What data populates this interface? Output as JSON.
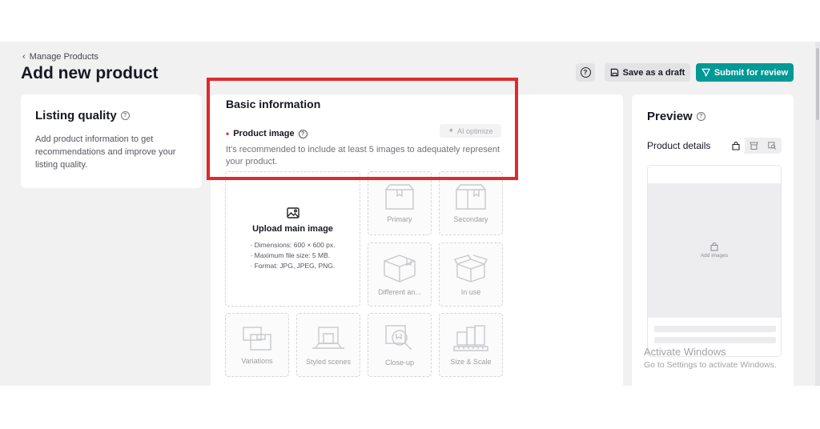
{
  "header": {
    "breadcrumb": "Manage Products",
    "title": "Add new product",
    "draft_label": "Save as a draft",
    "submit_label": "Submit for review"
  },
  "listing_quality": {
    "title": "Listing quality",
    "description": "Add product information to get recommendations and improve your listing quality."
  },
  "basic_info": {
    "title": "Basic information",
    "product_image_label": "Product image",
    "ai_optimize_label": "AI optimize",
    "hint": "It's recommended to include at least 5 images to adequately represent your product.",
    "upload": {
      "title": "Upload main image",
      "specs": [
        "· Dimensions: 600 × 600 px.",
        "· Maximum file size: 5 MB.",
        "· Format: JPG, JPEG, PNG."
      ]
    },
    "slots": [
      "Primary",
      "Secondary",
      "Different an...",
      "In use",
      "Variations",
      "Styled scenes",
      "Close-up",
      "Size & Scale"
    ]
  },
  "preview": {
    "title": "Preview",
    "details_label": "Product details",
    "add_images_label": "Add images"
  },
  "watermark": {
    "line1": "Activate Windows",
    "line2": "Go to Settings to activate Windows."
  },
  "colors": {
    "accent": "#009995",
    "highlight": "#e0292f",
    "required": "#e3304b"
  }
}
